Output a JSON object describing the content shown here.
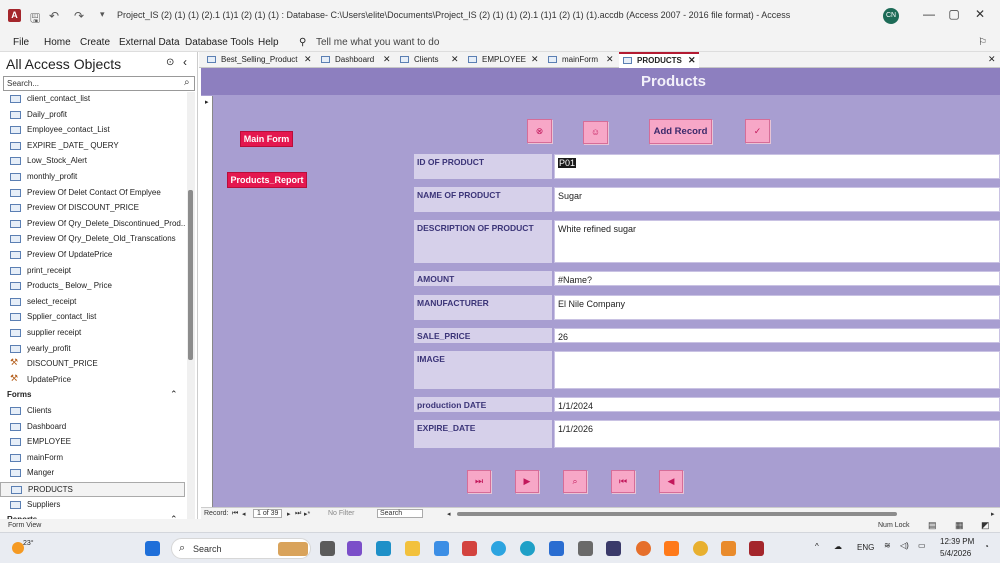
{
  "window": {
    "title": "Project_IS (2) (1) (1) (2).1 (1)1 (2) (1) (1) : Database- C:\\Users\\elite\\Documents\\Project_IS (2) (1) (1) (2).1 (1)1 (2) (1) (1).accdb (Access 2007 - 2016 file format) - Access",
    "user_initials": "CN",
    "app_letter": "A",
    "controls": [
      "—",
      "▢",
      "✕"
    ]
  },
  "ribbon": {
    "tabs": [
      "File",
      "Home",
      "Create",
      "External Data",
      "Database Tools",
      "Help"
    ],
    "tell_me": "Tell me what you want to do"
  },
  "nav": {
    "title": "All Access Objects",
    "search_placeholder": "Search...",
    "items": [
      {
        "label": "client_contact_list",
        "type": "query"
      },
      {
        "label": "Daily_profit",
        "type": "query"
      },
      {
        "label": "Employee_contact_List",
        "type": "query"
      },
      {
        "label": "EXPIRE _DATE_ QUERY",
        "type": "query"
      },
      {
        "label": "Low_Stock_Alert",
        "type": "query"
      },
      {
        "label": "monthly_profit",
        "type": "query"
      },
      {
        "label": "Preview Of Delet Contact Of Emplyee",
        "type": "query"
      },
      {
        "label": "Preview Of DISCOUNT_PRICE",
        "type": "query"
      },
      {
        "label": "Preview Of Qry_Delete_Discontinued_Prod...",
        "type": "query"
      },
      {
        "label": "Preview Of Qry_Delete_Old_Transcations",
        "type": "query"
      },
      {
        "label": "Preview Of UpdatePrice",
        "type": "query"
      },
      {
        "label": "print_receipt",
        "type": "query"
      },
      {
        "label": "Products_ Below_ Price",
        "type": "query"
      },
      {
        "label": "select_receipt",
        "type": "query"
      },
      {
        "label": "Spplier_contact_list",
        "type": "query"
      },
      {
        "label": "supplier receipt",
        "type": "query"
      },
      {
        "label": "yearly_profit",
        "type": "query"
      },
      {
        "label": "DISCOUNT_PRICE",
        "type": "macro"
      },
      {
        "label": "UpdatePrice",
        "type": "macro"
      },
      {
        "label": "Forms",
        "type": "group"
      },
      {
        "label": "Clients",
        "type": "form"
      },
      {
        "label": "Dashboard",
        "type": "form"
      },
      {
        "label": "EMPLOYEE",
        "type": "form"
      },
      {
        "label": "mainForm",
        "type": "form"
      },
      {
        "label": "Manger",
        "type": "form"
      },
      {
        "label": "PRODUCTS",
        "type": "form",
        "selected": true
      },
      {
        "label": "Suppliers",
        "type": "form"
      },
      {
        "label": "Reports",
        "type": "group"
      }
    ]
  },
  "doc_tabs": [
    {
      "label": "Best_Selling_Product"
    },
    {
      "label": "Dashboard"
    },
    {
      "label": "Clients"
    },
    {
      "label": "EMPLOYEE"
    },
    {
      "label": "mainForm"
    },
    {
      "label": "PRODUCTS",
      "active": true
    }
  ],
  "form": {
    "title": "Products",
    "buttons": {
      "main_form": "Main Form",
      "products_report": "Products_Report",
      "add_record": "Add Record",
      "delete_icon": "⊗",
      "undo_icon": "☺",
      "check_icon": "✓"
    },
    "fields": [
      {
        "label": "ID OF PRODUCT",
        "value": "P01"
      },
      {
        "label": "NAME OF PRODUCT",
        "value": "Sugar"
      },
      {
        "label": "DESCRIPTION OF PRODUCT",
        "value": "White refined sugar"
      },
      {
        "label": "AMOUNT",
        "value": "#Name?"
      },
      {
        "label": "MANUFACTURER",
        "value": "El Nile Company"
      },
      {
        "label": "SALE_PRICE",
        "value": "26"
      },
      {
        "label": "IMAGE",
        "value": ""
      },
      {
        "label": "production DATE",
        "value": "1/1/2024"
      },
      {
        "label": "EXPIRE_DATE",
        "value": "1/1/2026"
      }
    ],
    "nav_buttons": [
      "⏭",
      "▶",
      "⌕",
      "⏮",
      "◀"
    ]
  },
  "record_nav": {
    "label": "Record:",
    "position": "1 of 39",
    "filter": "No Filter",
    "search": "Search"
  },
  "status": {
    "left": "Form View",
    "num_lock": "Num Lock"
  },
  "taskbar": {
    "weather": "23°",
    "search": "Search",
    "lang": "ENG",
    "time": "12:39 PM",
    "date": "5/4/2026"
  }
}
